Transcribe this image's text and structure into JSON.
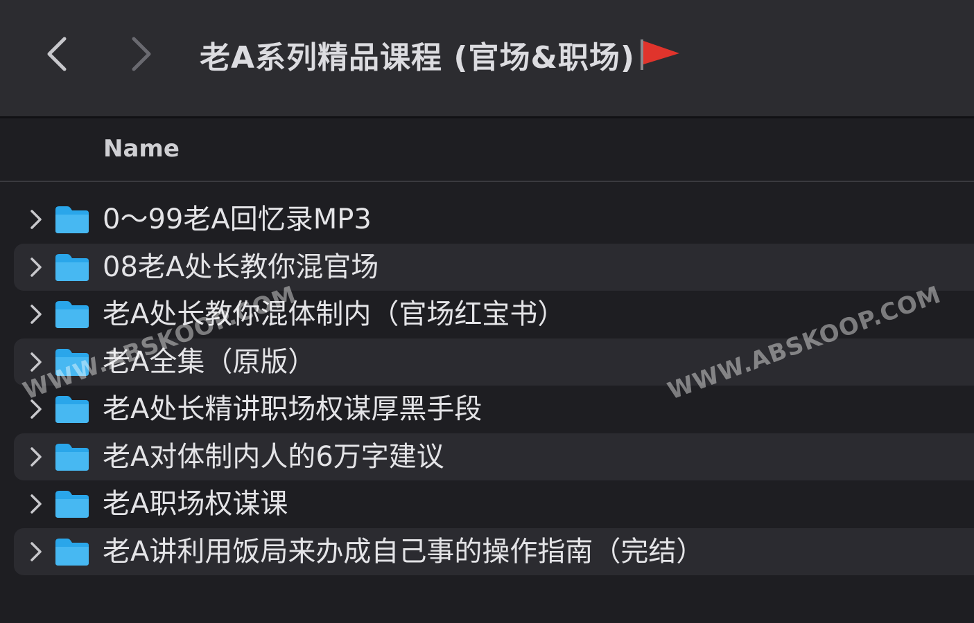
{
  "titlebar": {
    "title": "老A系列精品课程 (官场&职场)",
    "flag_icon": "red-flag-icon",
    "flag_color": "#e0342c"
  },
  "header": {
    "name_column": "Name"
  },
  "folder_color": "#2aa6ea",
  "rows": [
    {
      "label": "0～99老A回忆录MP3"
    },
    {
      "label": "08老A处长教你混官场"
    },
    {
      "label": "老A处长教你混体制内（官场红宝书）"
    },
    {
      "label": "老A全集（原版）"
    },
    {
      "label": "老A处长精讲职场权谋厚黑手段"
    },
    {
      "label": "老A对体制内人的6万字建议"
    },
    {
      "label": "老A职场权谋课"
    },
    {
      "label": "老A讲利用饭局来办成自己事的操作指南（完结）"
    }
  ],
  "watermarks": [
    {
      "text": "WWW.ABSKOOP.COM"
    },
    {
      "text": "WWW.ABSKOOP.COM"
    }
  ]
}
